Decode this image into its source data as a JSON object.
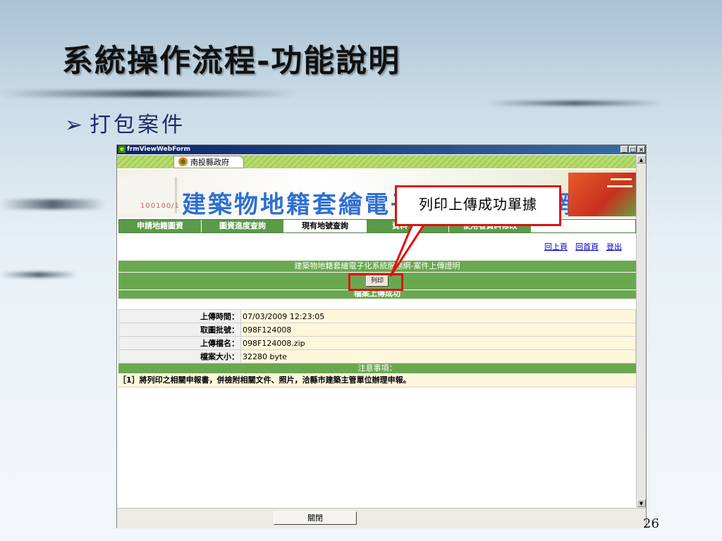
{
  "slide": {
    "title": "系統操作流程-功能說明",
    "bullet": "打包案件",
    "page_number": "26",
    "callout": "列印上傳成功單據"
  },
  "window": {
    "title": "frmViewWebForm",
    "buttons": [
      "_",
      "□",
      "×"
    ]
  },
  "banner": {
    "county": "南投縣政府",
    "title": "建築物地籍套繪電子化系統服務網",
    "number": "100100/1"
  },
  "nav": {
    "tabs": [
      {
        "label": "申請地籍圖資",
        "active": false
      },
      {
        "label": "圖資進度查詢",
        "active": false
      },
      {
        "label": "現有地號查詢",
        "active": true
      },
      {
        "label": "資料下載",
        "active": false
      },
      {
        "label": "使用者資料修改",
        "active": false
      }
    ]
  },
  "links": {
    "back": "回上頁",
    "home": "回首頁",
    "logout": "登出"
  },
  "form": {
    "header": "建築物地籍套繪電子化系統服務網-案件上傳證明",
    "print_label": "列印",
    "success": "檔案上傳成功",
    "rows": [
      {
        "label": "上傳時間：",
        "value": "07/03/2009 12:23:05"
      },
      {
        "label": "取圖批號：",
        "value": "098F124008"
      },
      {
        "label": "上傳檔名：",
        "value": "098F124008.zip"
      },
      {
        "label": "檔案大小：",
        "value": "32280 byte"
      }
    ],
    "notes_header": "注意事項：",
    "note": "［1］將列印之相關申報書，併檢附相關文件、照片，洽縣市建築主管單位辦理申報。",
    "close_label": "關閉"
  },
  "colors": {
    "accent": "#6aa84f",
    "banner_title": "#2f6fd0",
    "highlight": "#e01010",
    "bullet": "#1d2b67"
  }
}
